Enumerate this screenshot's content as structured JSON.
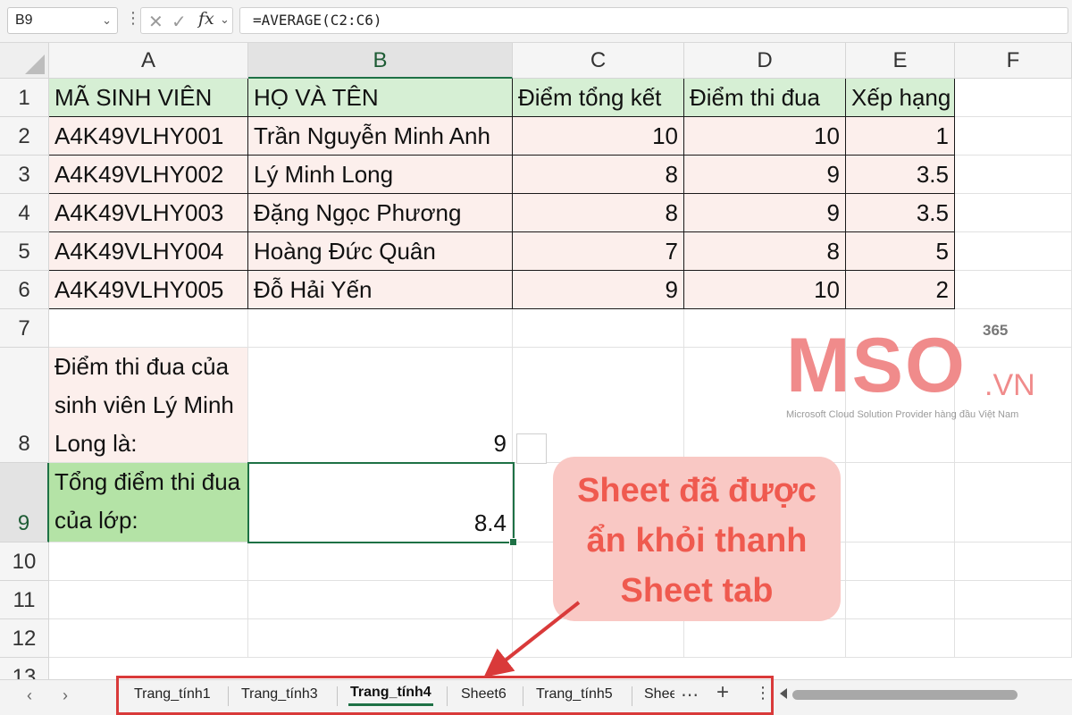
{
  "formula_bar": {
    "name_box": "B9",
    "fx_label": "fx",
    "formula": "=AVERAGE(C2:C6)"
  },
  "columns": [
    "A",
    "B",
    "C",
    "D",
    "E",
    "F"
  ],
  "rows": [
    "1",
    "2",
    "3",
    "4",
    "5",
    "6",
    "7",
    "8",
    "9",
    "10",
    "11",
    "12",
    "13"
  ],
  "table": {
    "headers": [
      "MÃ SINH VIÊN",
      "HỌ VÀ TÊN",
      "Điểm tổng kết",
      "Điểm thi đua",
      "Xếp hạng"
    ],
    "rows": [
      [
        "A4K49VLHY001",
        "Trần Nguyễn Minh Anh",
        "10",
        "10",
        "1"
      ],
      [
        "A4K49VLHY002",
        "Lý Minh Long",
        "8",
        "9",
        "3.5"
      ],
      [
        "A4K49VLHY003",
        "Đặng Ngọc Phương",
        "8",
        "9",
        "3.5"
      ],
      [
        "A4K49VLHY004",
        "Hoàng Đức Quân",
        "7",
        "8",
        "5"
      ],
      [
        "A4K49VLHY005",
        "Đỗ Hải Yến",
        "9",
        "10",
        "2"
      ]
    ]
  },
  "summary": {
    "a8_label": "Điểm thi đua của sinh viên Lý Minh Long là:",
    "b8_value": "9",
    "a9_label": "Tổng điểm thi đua của lớp:",
    "b9_value": "8.4"
  },
  "watermark": {
    "brand": "MSO",
    "superscript": "365",
    "suffix": ".VN",
    "tagline": "Microsoft Cloud Solution Provider hàng đầu Việt Nam",
    "color": "#f08b8b"
  },
  "callout": {
    "line1": "Sheet đã được",
    "line2": "ẩn khỏi thanh",
    "line3": "Sheet tab",
    "color": "#ef5a4f"
  },
  "sheet_tabs": {
    "tabs": [
      "Trang_tính1",
      "Trang_tính3",
      "Trang_tính4",
      "Sheet6",
      "Trang_tính5",
      "Shee"
    ],
    "active": "Trang_tính4",
    "more_icon": "ellipsis-icon",
    "add_icon": "plus-icon",
    "menu_icon": "vertical-dots-icon"
  },
  "colors": {
    "header_fill": "#d6efd4",
    "data_fill": "#fcefec",
    "summary_fill": "#b4e3a6",
    "highlight_border": "#d93a3a",
    "excel_green": "#1e7145"
  }
}
